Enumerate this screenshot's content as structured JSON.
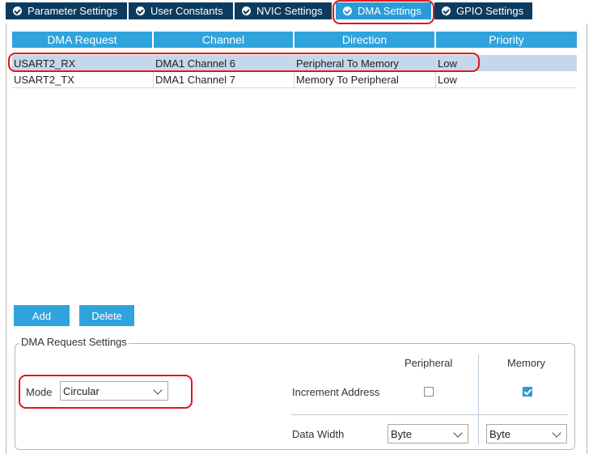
{
  "tabs": [
    {
      "label": "Parameter Settings",
      "icon": "check-circle-icon",
      "active": false
    },
    {
      "label": "User Constants",
      "icon": "check-circle-icon",
      "active": false
    },
    {
      "label": "NVIC Settings",
      "icon": "check-circle-icon",
      "active": false
    },
    {
      "label": "DMA Settings",
      "icon": "check-circle-icon",
      "active": true
    },
    {
      "label": "GPIO Settings",
      "icon": "check-circle-icon",
      "active": false
    }
  ],
  "table": {
    "headers": [
      "DMA Request",
      "Channel",
      "Direction",
      "Priority"
    ],
    "rows": [
      {
        "request": "USART2_RX",
        "channel": "DMA1 Channel 6",
        "direction": "Peripheral To Memory",
        "priority": "Low",
        "selected": true
      },
      {
        "request": "USART2_TX",
        "channel": "DMA1 Channel 7",
        "direction": "Memory To Peripheral",
        "priority": "Low",
        "selected": false
      }
    ]
  },
  "buttons": {
    "add": "Add",
    "delete": "Delete"
  },
  "settings": {
    "legend": "DMA Request Settings",
    "mode_label": "Mode",
    "mode_value": "Circular",
    "peripheral_header": "Peripheral",
    "memory_header": "Memory",
    "increment_label": "Increment Address",
    "peripheral_increment": false,
    "memory_increment": true,
    "data_width_label": "Data Width",
    "peripheral_width": "Byte",
    "memory_width": "Byte"
  },
  "colors": {
    "tab_bg": "#0c3b5f",
    "tab_active_bg": "#2b9bd6",
    "header_bg": "#2fa3dc",
    "selected_row": "#c4d7eb",
    "highlight": "#e01818"
  }
}
